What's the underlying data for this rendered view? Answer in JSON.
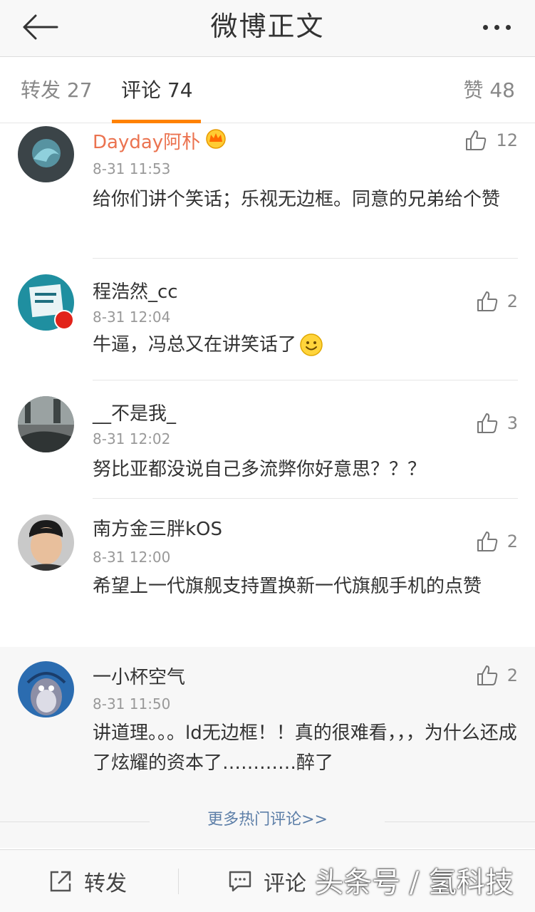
{
  "header": {
    "title": "微博正文"
  },
  "tabs": [
    {
      "label": "转发 27"
    },
    {
      "label": "评论 74"
    },
    {
      "label": "赞 48"
    }
  ],
  "comments": [
    {
      "user": "Dayday阿朴",
      "time": "8-31 11:53",
      "text": "给你们讲个笑话；乐视无边框。同意的兄弟给个赞",
      "likes": "12"
    },
    {
      "user": "程浩然_cc",
      "time": "8-31 12:04",
      "text": "牛逼，冯总又在讲笑话了",
      "likes": "2"
    },
    {
      "user": "__不是我_",
      "time": "8-31 12:02",
      "text": "努比亚都没说自己多流弊你好意思？？？",
      "likes": "3"
    },
    {
      "user": "南方金三胖kOS",
      "time": "8-31 12:00",
      "text": "希望上一代旗舰支持置换新一代旗舰手机的点赞",
      "likes": "2"
    },
    {
      "user": "一小杯空气",
      "time": "8-31 11:50",
      "text": "讲道理。。。ld无边框！！真的很难看，，，为什么还成了炫耀的资本了…………醉了",
      "likes": "2"
    }
  ],
  "more_hot_comments": "更多热门评论>>",
  "toolbar": {
    "repost_label": "转发",
    "comment_label": "评论"
  },
  "watermark": "头条号 / 氢科技",
  "colors": {
    "accent": "#ff8200",
    "vip_name": "#eb7350",
    "link": "#5d7fa8"
  }
}
